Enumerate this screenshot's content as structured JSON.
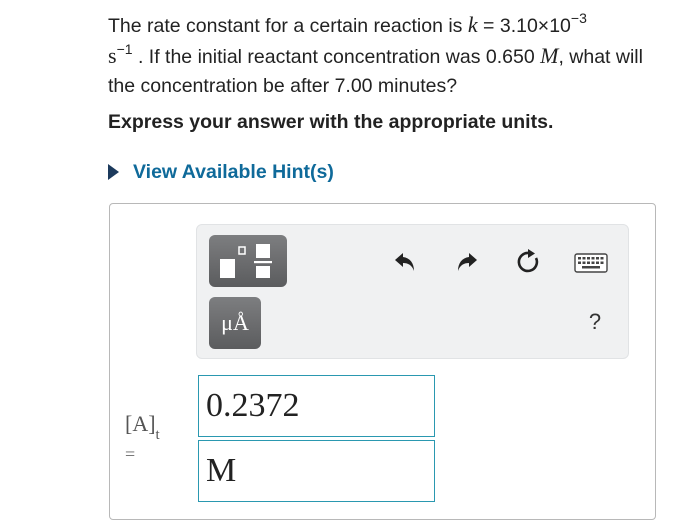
{
  "question": {
    "part1": "The rate constant for a certain reaction is ",
    "k_symbol": "k",
    "part2": " = 3.10×10",
    "exponent": "−3",
    "s_unit": "s",
    "s_exponent": "−1",
    "part3": " . If the initial reactant concentration was 0.650 ",
    "M_symbol": "M",
    "part4": ", what will the concentration be after 7.00 minutes?"
  },
  "instruction": "Express your answer with the appropriate units.",
  "hint": {
    "label": "View Available Hint(s)"
  },
  "toolbar": {
    "templates_icon": "templates-icon",
    "units_label": "μÅ",
    "undo_icon": "undo-icon",
    "redo_icon": "redo-icon",
    "reset_icon": "reset-icon",
    "keyboard_icon": "keyboard-icon",
    "help_label": "?"
  },
  "answer": {
    "variable": "[A]",
    "variable_sub": "t",
    "equals": "=",
    "value": "0.2372",
    "unit": "M"
  },
  "colors": {
    "hint_text": "#0f6a9a",
    "field_border": "#2a98b0",
    "toolbar_button": "#6b6c6e"
  }
}
